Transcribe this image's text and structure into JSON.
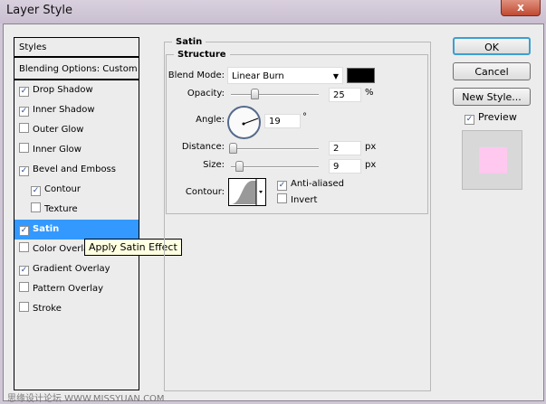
{
  "window": {
    "title": "Layer Style",
    "close": "x"
  },
  "sidebar": {
    "header": "Styles",
    "blending": "Blending Options: Custom",
    "items": [
      {
        "label": "Drop Shadow",
        "checked": true
      },
      {
        "label": "Inner Shadow",
        "checked": true
      },
      {
        "label": "Outer Glow",
        "checked": false
      },
      {
        "label": "Inner Glow",
        "checked": false
      },
      {
        "label": "Bevel and Emboss",
        "checked": true
      },
      {
        "label": "Contour",
        "checked": true
      },
      {
        "label": "Texture",
        "checked": false
      },
      {
        "label": "Satin",
        "checked": true,
        "selected": true
      },
      {
        "label": "Color Overlay",
        "checked": false
      },
      {
        "label": "Gradient Overlay",
        "checked": true
      },
      {
        "label": "Pattern Overlay",
        "checked": false
      },
      {
        "label": "Stroke",
        "checked": false
      }
    ]
  },
  "tooltip": "Apply Satin Effect",
  "panel": {
    "title": "Satin",
    "group": "Structure",
    "blend_mode_label": "Blend Mode:",
    "blend_mode": "Linear Burn",
    "color": "#000000",
    "opacity_label": "Opacity:",
    "opacity": "25",
    "opacity_unit": "%",
    "angle_label": "Angle:",
    "angle": "19",
    "angle_unit": "°",
    "distance_label": "Distance:",
    "distance": "2",
    "distance_unit": "px",
    "size_label": "Size:",
    "size": "9",
    "size_unit": "px",
    "contour_label": "Contour:",
    "anti_aliased": "Anti-aliased",
    "invert": "Invert"
  },
  "buttons": {
    "ok": "OK",
    "cancel": "Cancel",
    "new_style": "New Style...",
    "preview": "Preview"
  },
  "preview_color": "#ffc8ee",
  "watermark": "思缘设计论坛 WWW.MISSYUAN.COM"
}
